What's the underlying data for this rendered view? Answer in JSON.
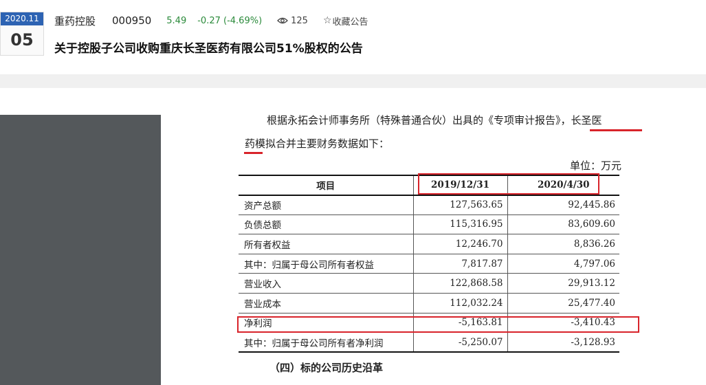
{
  "header": {
    "date_top": "2020.11",
    "date_day": "05",
    "stock_name": "重药控股",
    "stock_code": "000950",
    "price": "5.49",
    "change": "-0.27 (-4.69%)",
    "views": "125",
    "favorite_label": "收藏公告",
    "title": "关于控股子公司收购重庆长圣医药有限公司51%股权的公告"
  },
  "doc": {
    "para1": "根据永拓会计师事务所（特殊普通合伙）出具的《专项审计报告》，长圣医",
    "para2": "药模拟合并主要财务数据如下：",
    "unit": "单位：万元",
    "table": {
      "headers": [
        "项目",
        "2019/12/31",
        "2020/4/30"
      ],
      "rows": [
        [
          "资产总额",
          "127,563.65",
          "92,445.86"
        ],
        [
          "负债总额",
          "115,316.95",
          "83,609.60"
        ],
        [
          "所有者权益",
          "12,246.70",
          "8,836.26"
        ],
        [
          "其中：归属于母公司所有者权益",
          "7,817.87",
          "4,797.06"
        ],
        [
          "营业收入",
          "122,868.58",
          "29,913.12"
        ],
        [
          "营业成本",
          "112,032.24",
          "25,477.40"
        ],
        [
          "净利润",
          "-5,163.81",
          "-3,410.43"
        ],
        [
          "其中：归属于母公司所有者净利润",
          "-5,250.07",
          "-3,128.93"
        ]
      ]
    },
    "subheading": "（四）标的公司历史沿革"
  },
  "colors": {
    "accent_blue": "#2d63b3",
    "down_green": "#2a8a3a",
    "annotation_red": "#d8232a",
    "side_panel": "#54585b"
  },
  "icons": [
    "eye-icon",
    "star-icon"
  ]
}
